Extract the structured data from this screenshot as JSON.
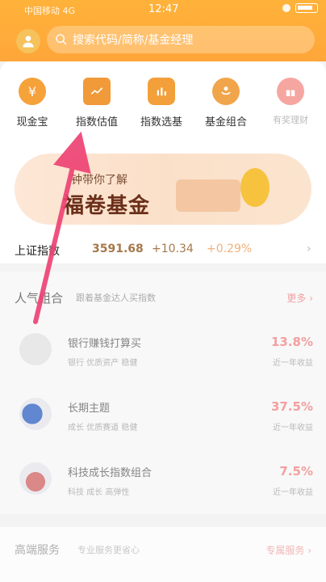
{
  "status_bar": {
    "carrier": "中国移动 4G",
    "time": "12:47"
  },
  "header": {
    "search_placeholder": "搜索代码/简称/基金经理"
  },
  "quick_icons": [
    {
      "label": "现金宝",
      "icon": "yen-icon",
      "color": "#f6a23a"
    },
    {
      "label": "指数估值",
      "icon": "chart-screen-icon",
      "color": "#f19a3a"
    },
    {
      "label": "指数选基",
      "icon": "bar-chart-icon",
      "color": "#f3a03a"
    },
    {
      "label": "基金组合",
      "icon": "smile-portfolio-icon",
      "color": "#f1a54b"
    },
    {
      "label": "有奖理财",
      "icon": "gift-icon",
      "color": "#f6a6a0"
    }
  ],
  "banner": {
    "subtitle": "钟带你了解",
    "title": "福卷基金"
  },
  "ticker": {
    "name": "上证指数",
    "value": "3591.68",
    "change": "+10.34",
    "percent": "+0.29%",
    "arrow": "›"
  },
  "section": {
    "title": "人气组合",
    "desc": "跟着基金达人买指数",
    "more": "更多 ›",
    "rows": [
      {
        "name": "银行赚钱打算买",
        "tags": "银行    优质资产    稳健",
        "pct": "13.8%",
        "pct_label": "近一年收益"
      },
      {
        "name": "长期主题",
        "tags": "成长    优质赛道    稳健",
        "pct": "37.5%",
        "pct_label": "近一年收益"
      },
      {
        "name": "科技成长指数组合",
        "tags": "科技    成长    高弹性",
        "pct": "7.5%",
        "pct_label": "近一年收益"
      }
    ]
  },
  "bottom": {
    "title": "高端服务",
    "desc": "专业服务更省心",
    "right": "专属服务 ›"
  }
}
